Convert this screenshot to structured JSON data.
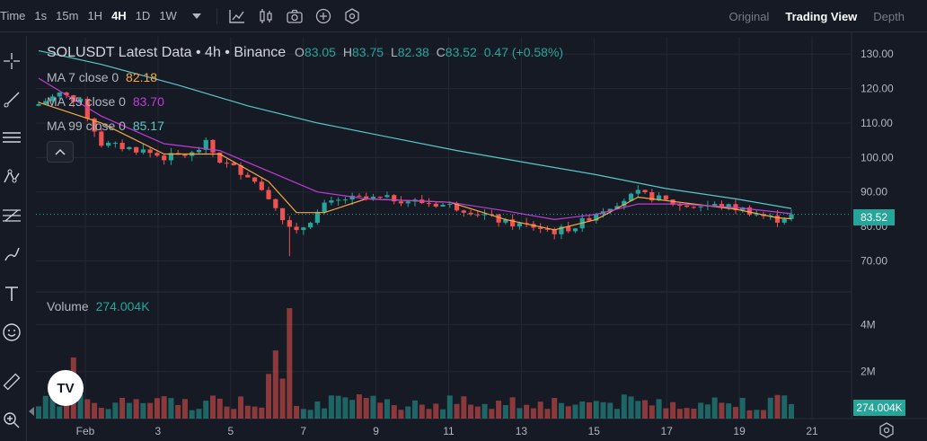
{
  "toolbar": {
    "intervals": [
      "Time",
      "1s",
      "15m",
      "1H",
      "4H",
      "1D",
      "1W"
    ],
    "active_interval": "4H",
    "view_modes": [
      "Original",
      "Trading View",
      "Depth"
    ],
    "active_view": "Trading View"
  },
  "legend": {
    "symbol": "SOLUSDT Latest Data • 4h • Binance",
    "o_label": "O",
    "o_value": "83.05",
    "h_label": "H",
    "h_value": "83.75",
    "l_label": "L",
    "l_value": "82.38",
    "c_label": "C",
    "c_value": "83.52",
    "change": "0.47 (+0.58%)",
    "ma7_label": "MA 7 close 0",
    "ma7_value": "82.18",
    "ma25_label": "MA 25 close 0",
    "ma25_value": "83.70",
    "ma99_label": "MA 99 close 0",
    "ma99_value": "85.17",
    "volume_label": "Volume",
    "volume_value": "274.004K"
  },
  "price_tag": "83.52",
  "volume_tag": "274.004K",
  "colors": {
    "up": "#26a69a",
    "down": "#ef5350",
    "ma7": "#f7a941",
    "ma25": "#c23bd6",
    "ma99": "#58c8c5",
    "background": "#161a25",
    "grid": "#242833",
    "text": "#b2b5be"
  },
  "icons": [
    "chevron-down-icon",
    "candles-icon",
    "indicators-icon",
    "camera-icon",
    "plus-circle-icon",
    "gear-icon",
    "crosshair-icon",
    "trendline-icon",
    "horizontal-lines-icon",
    "pattern-icon",
    "fib-icon",
    "brush-icon",
    "text-icon",
    "emoji-icon",
    "ruler-icon",
    "zoom-in-icon",
    "chevron-up-icon",
    "chevron-left-icon",
    "tradingview-logo"
  ],
  "chart_data": {
    "type": "candlestick",
    "price_axis": {
      "ticks": [
        "130.00",
        "120.00",
        "110.00",
        "100.00",
        "90.00",
        "80.00",
        "70.00"
      ],
      "range": [
        61,
        135
      ]
    },
    "volume_axis": {
      "ticks": [
        "4M",
        "2M"
      ],
      "range": [
        0,
        5200000
      ]
    },
    "x_axis": {
      "ticks": [
        "Feb",
        "3",
        "5",
        "7",
        "9",
        "11",
        "13",
        "15",
        "17",
        "19",
        "21"
      ]
    },
    "anchors": [
      {
        "t": 0,
        "price": 115.5
      },
      {
        "t": 3,
        "price": 118.5
      },
      {
        "t": 6,
        "price": 116
      },
      {
        "t": 9,
        "price": 104
      },
      {
        "t": 12,
        "price": 103
      },
      {
        "t": 15,
        "price": 102
      },
      {
        "t": 18,
        "price": 100
      },
      {
        "t": 22,
        "price": 101
      },
      {
        "t": 24,
        "price": 104
      },
      {
        "t": 26,
        "price": 99
      },
      {
        "t": 30,
        "price": 95
      },
      {
        "t": 33,
        "price": 89
      },
      {
        "t": 35,
        "price": 82
      },
      {
        "t": 37,
        "price": 78
      },
      {
        "t": 39,
        "price": 82
      },
      {
        "t": 41,
        "price": 86
      },
      {
        "t": 44,
        "price": 88
      },
      {
        "t": 47,
        "price": 88
      },
      {
        "t": 51,
        "price": 88
      },
      {
        "t": 55,
        "price": 87
      },
      {
        "t": 59,
        "price": 86
      },
      {
        "t": 63,
        "price": 84
      },
      {
        "t": 67,
        "price": 81
      },
      {
        "t": 71,
        "price": 80
      },
      {
        "t": 74,
        "price": 78.5
      },
      {
        "t": 77,
        "price": 80
      },
      {
        "t": 80,
        "price": 84
      },
      {
        "t": 83,
        "price": 87
      },
      {
        "t": 86,
        "price": 89.5
      },
      {
        "t": 89,
        "price": 88
      },
      {
        "t": 92,
        "price": 86
      },
      {
        "t": 95,
        "price": 86
      },
      {
        "t": 98,
        "price": 86
      },
      {
        "t": 101,
        "price": 85
      },
      {
        "t": 104,
        "price": 83
      },
      {
        "t": 106,
        "price": 82
      },
      {
        "t": 108,
        "price": 83.5
      }
    ],
    "candle_count": 109,
    "ma_lines": [
      {
        "name": "MA 7",
        "points": [
          [
            0,
            116
          ],
          [
            9,
            110
          ],
          [
            18,
            101
          ],
          [
            26,
            101
          ],
          [
            33,
            93
          ],
          [
            37,
            84
          ],
          [
            41,
            84
          ],
          [
            47,
            88
          ],
          [
            59,
            87
          ],
          [
            67,
            82
          ],
          [
            74,
            79
          ],
          [
            80,
            82
          ],
          [
            86,
            88.5
          ],
          [
            92,
            87
          ],
          [
            100,
            85
          ],
          [
            106,
            82.5
          ],
          [
            108,
            82.2
          ]
        ]
      },
      {
        "name": "MA 25",
        "points": [
          [
            0,
            123
          ],
          [
            9,
            112
          ],
          [
            18,
            104
          ],
          [
            26,
            102
          ],
          [
            33,
            96
          ],
          [
            40,
            90
          ],
          [
            47,
            88
          ],
          [
            59,
            87
          ],
          [
            67,
            84.5
          ],
          [
            74,
            82
          ],
          [
            80,
            83.5
          ],
          [
            86,
            86.5
          ],
          [
            92,
            86.5
          ],
          [
            100,
            85.5
          ],
          [
            108,
            83.7
          ]
        ]
      },
      {
        "name": "MA 99",
        "points": [
          [
            0,
            131
          ],
          [
            9,
            127
          ],
          [
            20,
            121
          ],
          [
            30,
            115
          ],
          [
            40,
            110
          ],
          [
            50,
            106
          ],
          [
            60,
            102
          ],
          [
            70,
            98.5
          ],
          [
            80,
            95
          ],
          [
            90,
            91
          ],
          [
            100,
            88
          ],
          [
            108,
            85.2
          ]
        ]
      }
    ],
    "volume_spikes": [
      [
        5,
        2600000
      ],
      [
        36,
        4700000
      ],
      [
        34,
        2900000
      ],
      [
        33,
        1900000
      ],
      [
        35,
        1700000
      ]
    ]
  }
}
